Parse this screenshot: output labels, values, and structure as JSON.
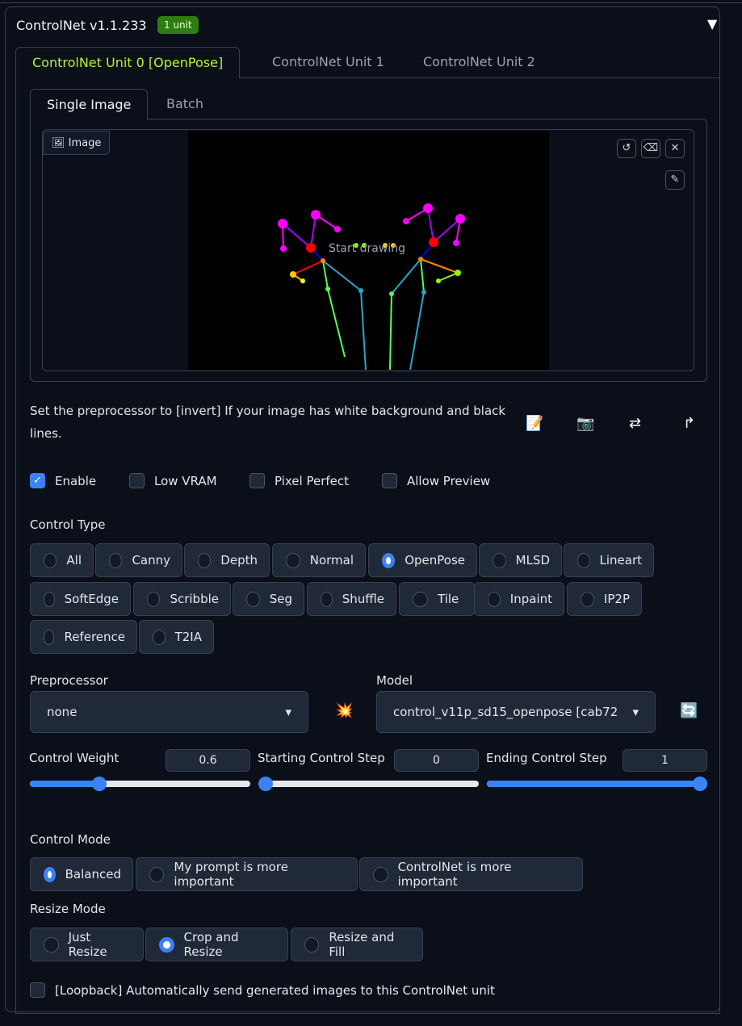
{
  "header": {
    "title": "ControlNet v1.1.233",
    "badge": "1 unit",
    "collapse_icon": "▼"
  },
  "unit_tabs": [
    "ControlNet Unit 0 [OpenPose]",
    "ControlNet Unit 1",
    "ControlNet Unit 2"
  ],
  "image_tabs": [
    "Single Image",
    "Batch"
  ],
  "image": {
    "label": "Image",
    "overlay_text": "Start drawing"
  },
  "note": "Set the preprocessor to [invert] If your image has white background and black lines.",
  "checkboxes": [
    {
      "label": "Enable",
      "checked": true
    },
    {
      "label": "Low VRAM",
      "checked": false
    },
    {
      "label": "Pixel Perfect",
      "checked": false
    },
    {
      "label": "Allow Preview",
      "checked": false
    }
  ],
  "control_type": {
    "label": "Control Type",
    "options": [
      "All",
      "Canny",
      "Depth",
      "Normal",
      "OpenPose",
      "MLSD",
      "Lineart",
      "SoftEdge",
      "Scribble",
      "Seg",
      "Shuffle",
      "Tile",
      "Inpaint",
      "IP2P",
      "Reference",
      "T2IA"
    ],
    "selected": "OpenPose"
  },
  "preprocessor": {
    "label": "Preprocessor",
    "value": "none"
  },
  "model": {
    "label": "Model",
    "value": "control_v11p_sd15_openpose [cab72"
  },
  "sliders": [
    {
      "label": "Control Weight",
      "value": "0.6",
      "min": 0,
      "max": 2,
      "v": 0.6
    },
    {
      "label": "Starting Control Step",
      "value": "0",
      "min": 0,
      "max": 1,
      "v": 0
    },
    {
      "label": "Ending Control Step",
      "value": "1",
      "min": 0,
      "max": 1,
      "v": 1
    }
  ],
  "control_mode": {
    "label": "Control Mode",
    "options": [
      "Balanced",
      "My prompt is more important",
      "ControlNet is more important"
    ],
    "selected": "Balanced"
  },
  "resize_mode": {
    "label": "Resize Mode",
    "options": [
      "Just Resize",
      "Crop and Resize",
      "Resize and Fill"
    ],
    "selected": "Crop and Resize"
  },
  "loopback": {
    "label": "[Loopback] Automatically send generated images to this ControlNet unit",
    "checked": false
  }
}
